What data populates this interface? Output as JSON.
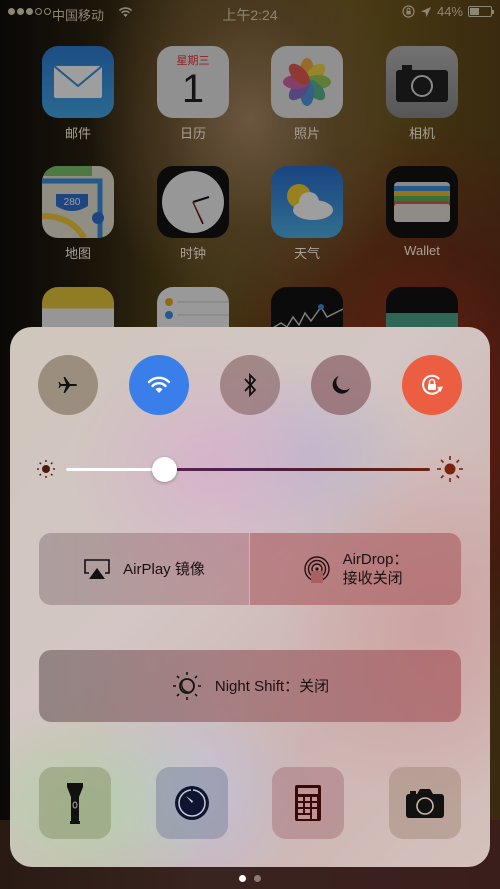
{
  "status_bar": {
    "signal_bars_filled": 3,
    "signal_bars_total": 5,
    "carrier": "中国移动",
    "time": "上午2:24",
    "battery_percent": "44%",
    "battery_level": 0.44,
    "icons": [
      "wifi-icon",
      "orientation-lock-icon",
      "location-arrow-icon",
      "battery-icon"
    ]
  },
  "home_screen": {
    "apps": [
      {
        "label": "邮件",
        "icon": "mail-icon"
      },
      {
        "label": "日历",
        "icon": "calendar-icon",
        "weekday": "星期三",
        "day": "1"
      },
      {
        "label": "照片",
        "icon": "photos-icon"
      },
      {
        "label": "相机",
        "icon": "camera-icon"
      },
      {
        "label": "地图",
        "icon": "maps-icon",
        "shield": "280"
      },
      {
        "label": "时钟",
        "icon": "clock-icon"
      },
      {
        "label": "天气",
        "icon": "weather-icon"
      },
      {
        "label": "Wallet",
        "icon": "wallet-icon"
      },
      {
        "label": "",
        "icon": "notes-icon"
      },
      {
        "label": "",
        "icon": "reminders-icon"
      },
      {
        "label": "",
        "icon": "stocks-icon"
      },
      {
        "label": "",
        "icon": "videos-icon"
      }
    ]
  },
  "control_center": {
    "toggles": [
      {
        "name": "airplane-mode",
        "icon": "airplane-icon",
        "active": false
      },
      {
        "name": "wifi",
        "icon": "wifi-icon",
        "active": true,
        "color": "#3a7fe9"
      },
      {
        "name": "bluetooth",
        "icon": "bluetooth-icon",
        "active": false
      },
      {
        "name": "do-not-disturb",
        "icon": "moon-icon",
        "active": false
      },
      {
        "name": "rotation-lock",
        "icon": "rotation-lock-icon",
        "active": true,
        "color": "#ec5e42"
      }
    ],
    "brightness": {
      "value": 0.27,
      "min_icon": "sun-small-icon",
      "max_icon": "sun-large-icon"
    },
    "airplay": {
      "label": "AirPlay 镜像",
      "icon": "airplay-icon"
    },
    "airdrop": {
      "line1": "AirDrop：",
      "line2": "接收关闭",
      "icon": "airdrop-icon"
    },
    "night_shift": {
      "label": "Night Shift：关闭",
      "icon": "night-shift-icon"
    },
    "shortcuts": [
      {
        "name": "flashlight",
        "icon": "flashlight-icon"
      },
      {
        "name": "timer",
        "icon": "timer-icon"
      },
      {
        "name": "calculator",
        "icon": "calculator-icon"
      },
      {
        "name": "camera",
        "icon": "camera-icon"
      }
    ]
  },
  "page_indicator": {
    "current": 1,
    "total": 2
  }
}
